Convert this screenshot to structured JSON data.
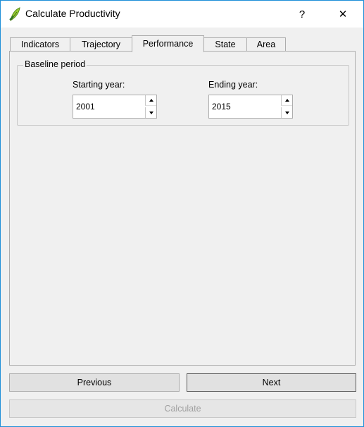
{
  "window": {
    "title": "Calculate Productivity",
    "help_label": "?",
    "close_label": "✕",
    "app_icon": "qgis-leaf-icon"
  },
  "tabs": [
    {
      "label": "Indicators",
      "active": false
    },
    {
      "label": "Trajectory",
      "active": false
    },
    {
      "label": "Performance",
      "active": true
    },
    {
      "label": "State",
      "active": false
    },
    {
      "label": "Area",
      "active": false
    }
  ],
  "baseline": {
    "group_title": "Baseline period",
    "start_label": "Starting year:",
    "start_value": "2001",
    "end_label": "Ending year:",
    "end_value": "2015"
  },
  "buttons": {
    "previous": "Previous",
    "next": "Next",
    "calculate": "Calculate"
  },
  "colors": {
    "accent": "#1e8fd8",
    "leaf_green": "#9acd32"
  }
}
